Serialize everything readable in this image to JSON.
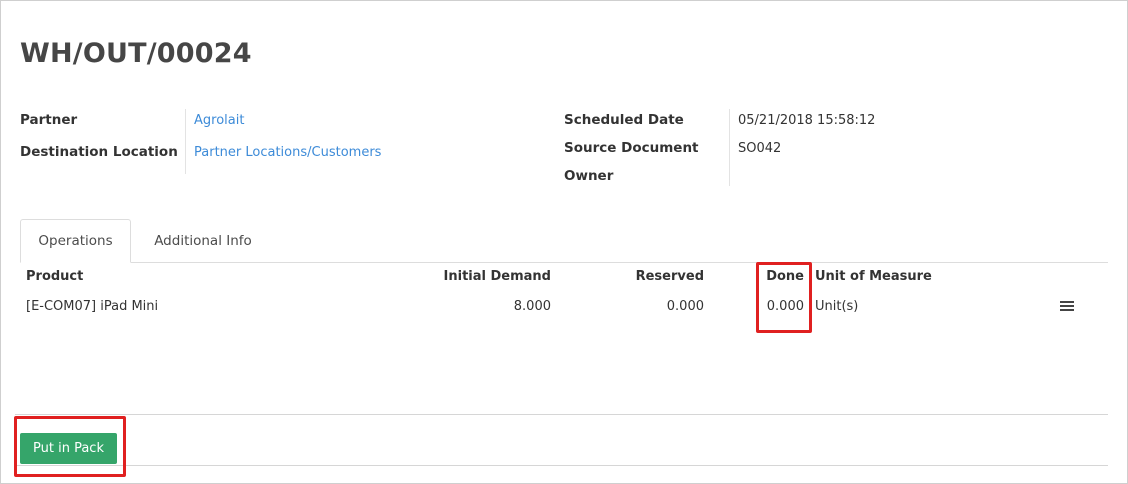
{
  "record": {
    "title": "WH/OUT/00024"
  },
  "left_fields": {
    "partner_label": "Partner",
    "partner_value": "Agrolait",
    "destination_label": "Destination Location",
    "destination_value": "Partner Locations/Customers"
  },
  "right_fields": {
    "scheduled_label": "Scheduled Date",
    "scheduled_value": "05/21/2018 15:58:12",
    "source_label": "Source Document",
    "source_value": "SO042",
    "owner_label": "Owner"
  },
  "tabs": [
    {
      "label": "Operations",
      "active": true
    },
    {
      "label": "Additional Info",
      "active": false
    }
  ],
  "table": {
    "columns": [
      "Product",
      "Initial Demand",
      "Reserved",
      "Done",
      "Unit of Measure"
    ],
    "rows": [
      {
        "product": "[E-COM07] iPad Mini",
        "initial_demand": "8.000",
        "reserved": "0.000",
        "done": "0.000",
        "uom": "Unit(s)"
      }
    ]
  },
  "buttons": {
    "put_in_pack": "Put in Pack"
  },
  "colors": {
    "link": "#3d8bd8",
    "primary_button": "#35a56a",
    "highlight": "#e02020"
  },
  "icons": {
    "row_detail": "list-icon"
  }
}
